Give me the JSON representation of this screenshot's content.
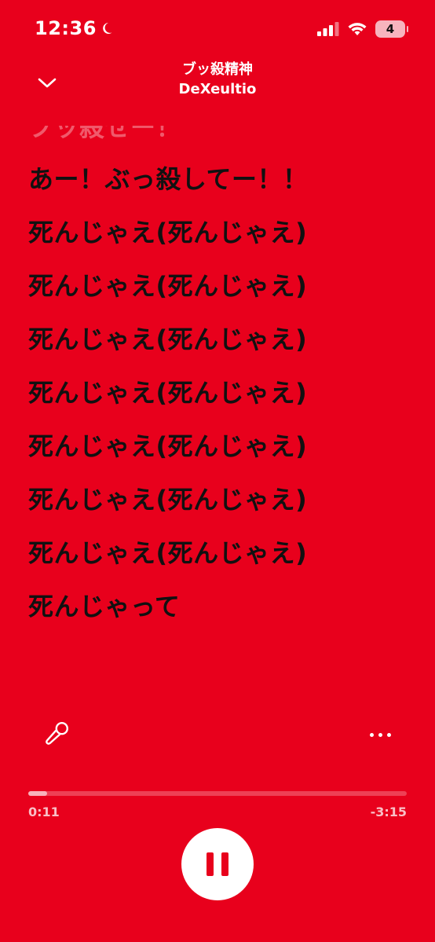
{
  "status_bar": {
    "time": "12:36",
    "battery": "4"
  },
  "header": {
    "song_title": "ブッ殺精神",
    "artist": "DeXeultio"
  },
  "lyrics": {
    "previous_line": "ブッ殺せー！",
    "lines": [
      "あー！ぶっ殺してー！！",
      "死んじゃえ(死んじゃえ)",
      "死んじゃえ(死んじゃえ)",
      "死んじゃえ(死んじゃえ)",
      "死んじゃえ(死んじゃえ)",
      "死んじゃえ(死んじゃえ)",
      "死んじゃえ(死んじゃえ)",
      "死んじゃえ(死んじゃえ)",
      "死んじゃって"
    ]
  },
  "playback": {
    "elapsed": "0:11",
    "remaining": "-3:15",
    "progress_fraction": 0.05
  },
  "colors": {
    "background": "#E8001C",
    "lyric_text": "#111111"
  },
  "icons": {
    "collapse": "chevron-down-icon",
    "mic": "microphone-icon",
    "more": "more-dots-icon",
    "pause": "pause-icon"
  }
}
